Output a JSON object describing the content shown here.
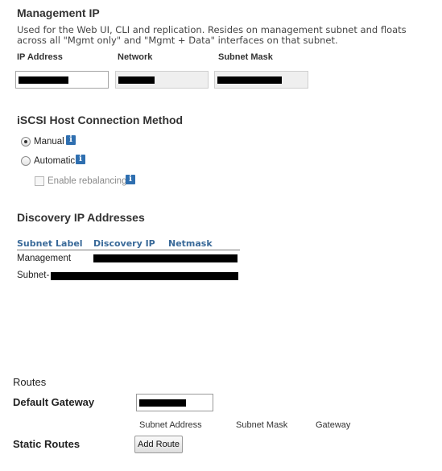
{
  "management_ip": {
    "title": "Management IP",
    "description": "Used for the Web UI, CLI and replication. Resides on management subnet and floats across all \"Mgmt only\" and \"Mgmt + Data\" interfaces on that subnet.",
    "columns": {
      "ip_address": "IP Address",
      "network": "Network",
      "subnet_mask": "Subnet Mask"
    }
  },
  "iscsi": {
    "title": "iSCSI Host Connection Method",
    "options": [
      {
        "label": "Manual",
        "selected": true
      },
      {
        "label": "Automatic",
        "selected": false
      }
    ],
    "rebalancing": {
      "label": "Enable rebalancing",
      "checked": false,
      "disabled": true
    },
    "info_glyph": "i"
  },
  "discovery": {
    "title": "Discovery IP Addresses",
    "headers": [
      "Subnet Label",
      "Discovery IP",
      "Netmask"
    ],
    "rows": [
      {
        "label": "Management"
      },
      {
        "label": "Subnet-"
      }
    ]
  },
  "routes": {
    "title": "Routes",
    "default_gateway_label": "Default Gateway",
    "static_routes_label": "Static Routes",
    "columns": [
      "Subnet Address",
      "Subnet Mask",
      "Gateway"
    ],
    "add_route_label": "Add Route"
  },
  "icons": {
    "info": "info-icon"
  },
  "colors": {
    "info_icon": "#2f6fb0",
    "table_header": "#3a6a99",
    "redaction": "#000000"
  }
}
